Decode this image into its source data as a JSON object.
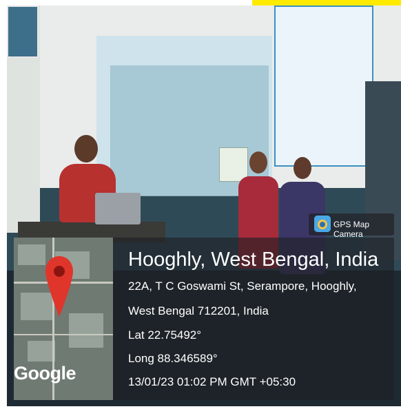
{
  "badge": {
    "label": "GPS Map Camera",
    "icon": "map-camera-icon"
  },
  "location": {
    "title": "Hooghly, West Bengal, India",
    "address_line1": "22A, T C Goswami St, Serampore, Hooghly,",
    "address_line2": "West Bengal 712201, India",
    "lat": "Lat 22.75492°",
    "long": "Long 88.346589°",
    "timestamp": "13/01/23 01:02 PM GMT +05:30"
  },
  "map": {
    "provider": "Google",
    "pin_color": "#e0352b"
  },
  "colors": {
    "overlay": "#1e1e24",
    "badge_bg": "#232328",
    "highlight": "#ffea00"
  }
}
